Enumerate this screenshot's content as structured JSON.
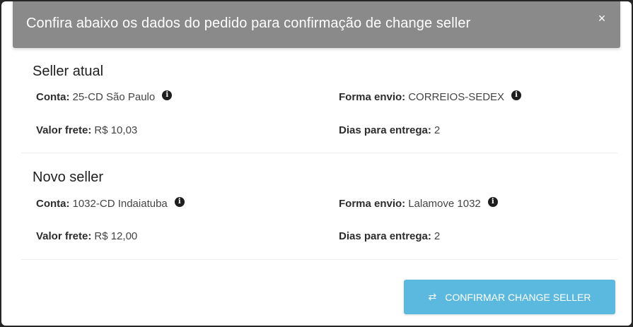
{
  "header": {
    "title": "Confira abaixo os dados do pedido para confirmação de change seller",
    "close_symbol": "×"
  },
  "seller_atual": {
    "title": "Seller atual",
    "conta_label": "Conta:",
    "conta_value": "25-CD São Paulo",
    "forma_envio_label": "Forma envio:",
    "forma_envio_value": "CORREIOS-SEDEX",
    "valor_frete_label": "Valor frete:",
    "valor_frete_value": "R$ 10,03",
    "dias_label": "Dias para entrega:",
    "dias_value": "2"
  },
  "novo_seller": {
    "title": "Novo seller",
    "conta_label": "Conta:",
    "conta_value": "1032-CD Indaiatuba",
    "forma_envio_label": "Forma envio:",
    "forma_envio_value": "Lalamove 1032",
    "valor_frete_label": "Valor frete:",
    "valor_frete_value": "R$ 12,00",
    "dias_label": "Dias para entrega:",
    "dias_value": "2"
  },
  "actions": {
    "confirm_label": "CONFIRMAR CHANGE SELLER",
    "confirm_icon": "⇄"
  },
  "icons": {
    "info": "i"
  },
  "colors": {
    "header_bg": "#8a8a8a",
    "confirm_bg": "#5bb9df"
  }
}
